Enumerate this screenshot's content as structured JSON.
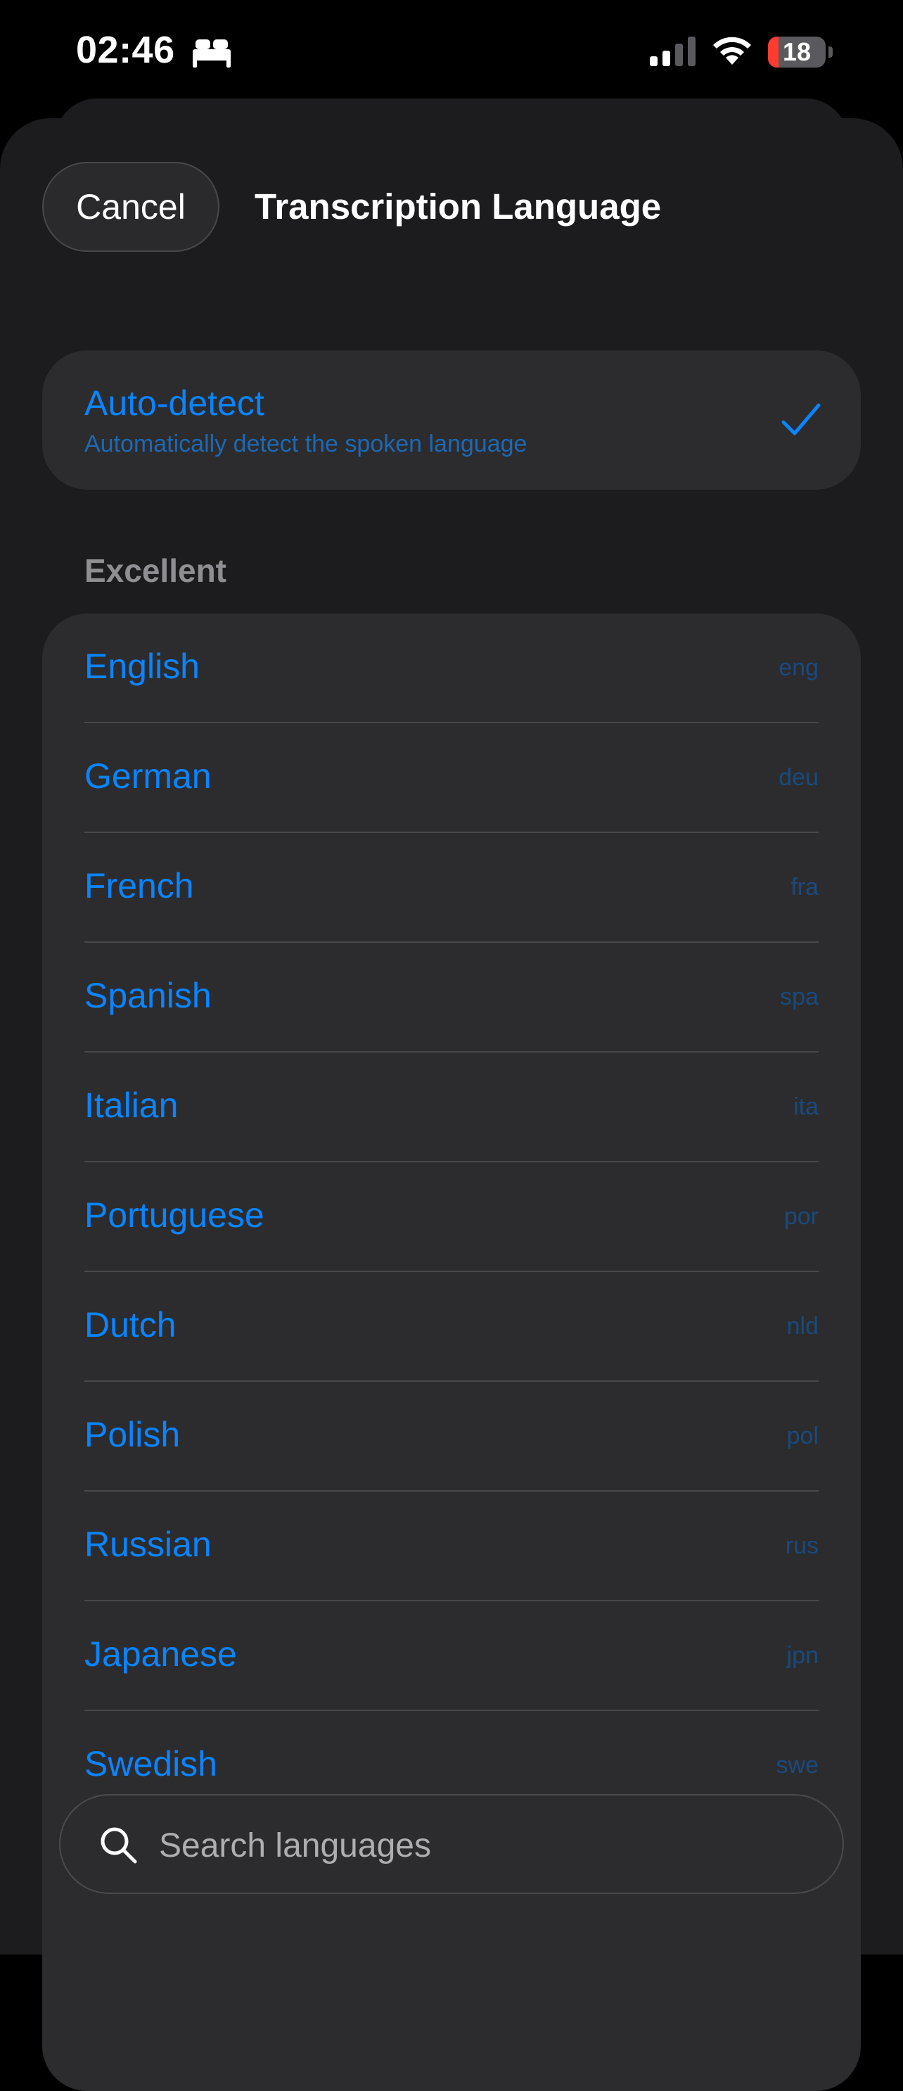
{
  "status_bar": {
    "time": "02:46",
    "focus_icon": "bed-icon",
    "signal_icon": "cellular-signal-icon",
    "wifi_icon": "wifi-icon",
    "battery_level": "18",
    "battery_fraction": 0.18,
    "battery_color": "#ff3b30"
  },
  "header": {
    "cancel_label": "Cancel",
    "title": "Transcription Language"
  },
  "auto_detect": {
    "title": "Auto-detect",
    "subtitle": "Automatically detect the spoken language",
    "selected": true,
    "check_icon": "checkmark-icon"
  },
  "section": {
    "title": "Excellent"
  },
  "languages": [
    {
      "name": "English",
      "code": "eng"
    },
    {
      "name": "German",
      "code": "deu"
    },
    {
      "name": "French",
      "code": "fra"
    },
    {
      "name": "Spanish",
      "code": "spa"
    },
    {
      "name": "Italian",
      "code": "ita"
    },
    {
      "name": "Portuguese",
      "code": "por"
    },
    {
      "name": "Dutch",
      "code": "nld"
    },
    {
      "name": "Polish",
      "code": "pol"
    },
    {
      "name": "Russian",
      "code": "rus"
    },
    {
      "name": "Japanese",
      "code": "jpn"
    },
    {
      "name": "Swedish",
      "code": "swe"
    }
  ],
  "search": {
    "placeholder": "Search languages",
    "icon": "search-icon"
  },
  "colors": {
    "accent": "#0a84ff",
    "background": "#1c1c1e",
    "card": "#2c2c2e"
  }
}
